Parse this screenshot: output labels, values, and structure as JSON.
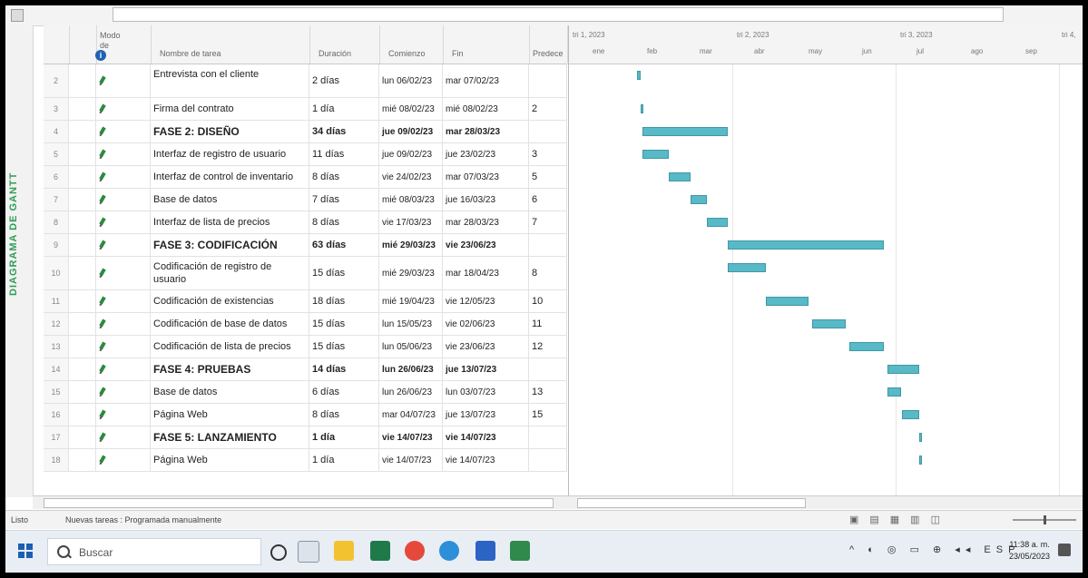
{
  "vertical_label": "DIAGRAMA DE GANTT",
  "table": {
    "headers": {
      "mode": "Modo de",
      "name": "Nombre de tarea",
      "duration": "Duración",
      "start": "Comienzo",
      "end": "Fin",
      "pred": "Predece"
    },
    "rows": [
      {
        "n": "2",
        "name": "Entrevista con el cliente",
        "dur": "2 días",
        "start": "lun 06/02/23",
        "end": "mar 07/02/23",
        "pred": "",
        "bold": false,
        "tall": true
      },
      {
        "n": "3",
        "name": "Firma del contrato",
        "dur": "1 día",
        "start": "mié 08/02/23",
        "end": "mié 08/02/23",
        "pred": "2",
        "bold": false
      },
      {
        "n": "4",
        "name": "FASE 2: DISEÑO",
        "dur": "34 días",
        "start": "jue 09/02/23",
        "end": "mar 28/03/23",
        "pred": "",
        "bold": true
      },
      {
        "n": "5",
        "name": "Interfaz de registro de usuario",
        "dur": "11 días",
        "start": "jue 09/02/23",
        "end": "jue 23/02/23",
        "pred": "3",
        "bold": false
      },
      {
        "n": "6",
        "name": "Interfaz de control de inventario",
        "dur": "8 días",
        "start": "vie 24/02/23",
        "end": "mar 07/03/23",
        "pred": "5",
        "bold": false
      },
      {
        "n": "7",
        "name": "Base de datos",
        "dur": "7 días",
        "start": "mié 08/03/23",
        "end": "jue 16/03/23",
        "pred": "6",
        "bold": false
      },
      {
        "n": "8",
        "name": "Interfaz de lista de precios",
        "dur": "8 días",
        "start": "vie 17/03/23",
        "end": "mar 28/03/23",
        "pred": "7",
        "bold": false
      },
      {
        "n": "9",
        "name": "FASE 3: CODIFICACIÓN",
        "dur": "63 días",
        "start": "mié 29/03/23",
        "end": "vie 23/06/23",
        "pred": "",
        "bold": true
      },
      {
        "n": "10",
        "name": "Codificación de registro de usuario",
        "dur": "15 días",
        "start": "mié 29/03/23",
        "end": "mar 18/04/23",
        "pred": "8",
        "bold": false,
        "tall": true
      },
      {
        "n": "11",
        "name": "Codificación de existencias",
        "dur": "18 días",
        "start": "mié 19/04/23",
        "end": "vie 12/05/23",
        "pred": "10",
        "bold": false
      },
      {
        "n": "12",
        "name": "Codificación de base de datos",
        "dur": "15 días",
        "start": "lun 15/05/23",
        "end": "vie 02/06/23",
        "pred": "11",
        "bold": false
      },
      {
        "n": "13",
        "name": "Codificación de lista de precios",
        "dur": "15 días",
        "start": "lun 05/06/23",
        "end": "vie 23/06/23",
        "pred": "12",
        "bold": false
      },
      {
        "n": "14",
        "name": "FASE 4: PRUEBAS",
        "dur": "14 días",
        "start": "lun 26/06/23",
        "end": "jue 13/07/23",
        "pred": "",
        "bold": true
      },
      {
        "n": "15",
        "name": "Base de datos",
        "dur": "6 días",
        "start": "lun 26/06/23",
        "end": "lun 03/07/23",
        "pred": "13",
        "bold": false
      },
      {
        "n": "16",
        "name": "Página Web",
        "dur": "8 días",
        "start": "mar 04/07/23",
        "end": "jue 13/07/23",
        "pred": "15",
        "bold": false
      },
      {
        "n": "17",
        "name": "FASE 5: LANZAMIENTO",
        "dur": "1 día",
        "start": "vie 14/07/23",
        "end": "vie 14/07/23",
        "pred": "",
        "bold": true
      },
      {
        "n": "18",
        "name": "Página Web",
        "dur": "1 día",
        "start": "vie 14/07/23",
        "end": "vie 14/07/23",
        "pred": "",
        "bold": false
      }
    ]
  },
  "gantt": {
    "quarters": [
      "tri 1, 2023",
      "tri 2, 2023",
      "tri 3, 2023",
      "tri 4,"
    ],
    "months": [
      "ene",
      "feb",
      "mar",
      "abr",
      "may",
      "jun",
      "jul",
      "ago",
      "sep"
    ]
  },
  "status": {
    "ready": "Listo",
    "new_tasks": "Nuevas tareas : Programada manualmente"
  },
  "taskbar": {
    "search_placeholder": "Buscar",
    "time": "11:38 a. m.",
    "date": "23/05/2023",
    "lang": "ESP"
  },
  "colors": {
    "bar": "#58b9c7",
    "accent": "#2e9e54"
  }
}
